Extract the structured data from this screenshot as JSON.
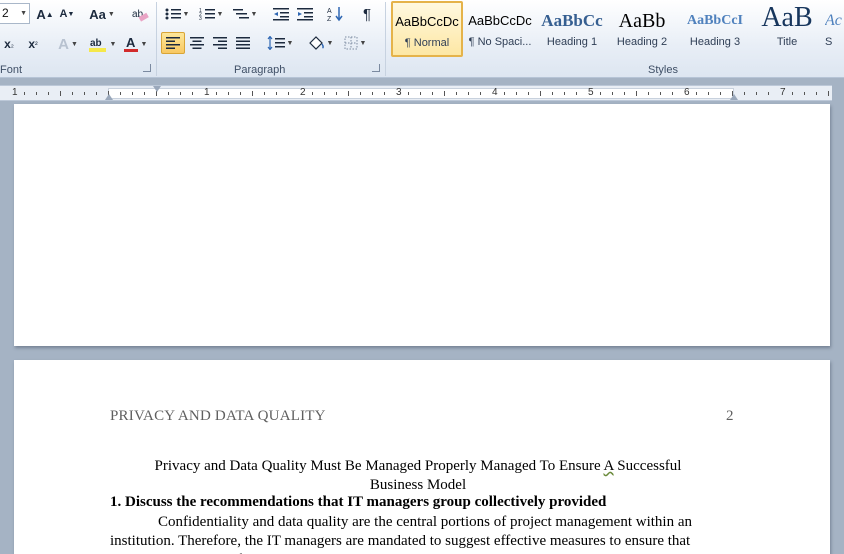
{
  "ribbon": {
    "font_size": "2",
    "groups": {
      "font": "Font",
      "paragraph": "Paragraph",
      "styles": "Styles"
    },
    "change_case_label": "Aa",
    "styles": [
      {
        "preview": "AaBbCcDc",
        "name": "¶ Normal"
      },
      {
        "preview": "AaBbCcDc",
        "name": "¶ No Spaci..."
      },
      {
        "preview": "AaBbCc",
        "name": "Heading 1"
      },
      {
        "preview": "AaBb",
        "name": "Heading 2"
      },
      {
        "preview": "AaBbCcI",
        "name": "Heading 3"
      },
      {
        "preview": "AaB",
        "name": "Title"
      },
      {
        "preview": "Ac",
        "name": "S"
      }
    ],
    "colors": {
      "highlight": "#f5e84a",
      "font_color": "#d22b2b",
      "accent": "#e5b34a"
    }
  },
  "ruler": {
    "numbers": [
      "1",
      "1",
      "2",
      "3",
      "4",
      "5",
      "6",
      "7"
    ]
  },
  "document": {
    "header": "PRIVACY AND DATA QUALITY",
    "page_number": "2",
    "title_line1_before": "Privacy and Data Quality Must Be Managed Properly Managed To Ensure ",
    "title_line1_marked": "A",
    "title_line1_after": " Successful",
    "title_line2": "Business Model",
    "heading": "1. Discuss the recommendations that IT managers group collectively  provided",
    "paragraph": "Confidentiality and data quality are the central portions of project management  within an institution.  Therefore, the IT managers are mandated to suggest effective measures  to ensure that privacy and quality of data are upheld at all times within the organization."
  }
}
